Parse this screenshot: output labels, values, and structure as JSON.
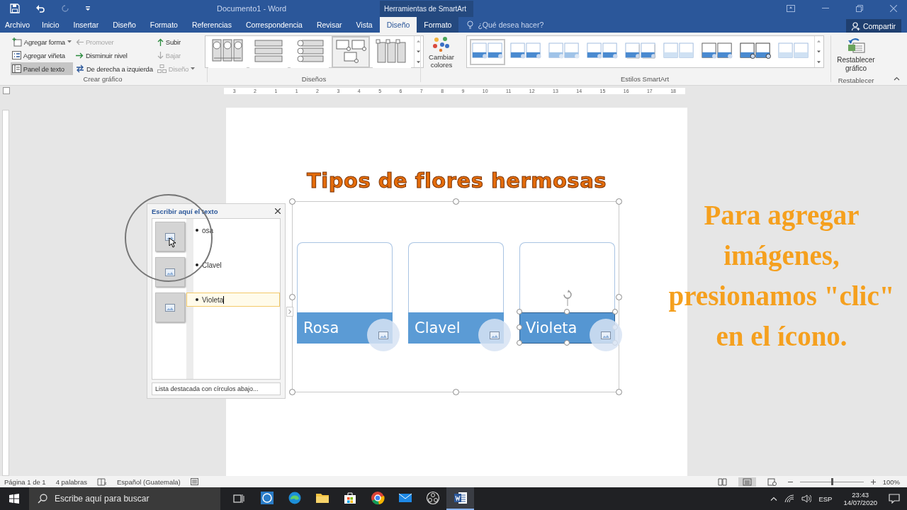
{
  "title_bar": {
    "document_title": "Documento1 - Word",
    "context_title": "Herramientas de SmartArt"
  },
  "ribbon_tabs": [
    {
      "label": "Archivo",
      "selected": false,
      "kind": "file"
    },
    {
      "label": "Inicio",
      "selected": false,
      "kind": "main"
    },
    {
      "label": "Insertar",
      "selected": false,
      "kind": "main"
    },
    {
      "label": "Diseño",
      "selected": false,
      "kind": "main"
    },
    {
      "label": "Formato",
      "selected": false,
      "kind": "main"
    },
    {
      "label": "Referencias",
      "selected": false,
      "kind": "main"
    },
    {
      "label": "Correspondencia",
      "selected": false,
      "kind": "main"
    },
    {
      "label": "Revisar",
      "selected": false,
      "kind": "main"
    },
    {
      "label": "Vista",
      "selected": false,
      "kind": "main"
    },
    {
      "label": "Diseño",
      "selected": true,
      "kind": "context"
    },
    {
      "label": "Formato",
      "selected": false,
      "kind": "context"
    }
  ],
  "tell_me": {
    "placeholder": "¿Qué desea hacer?"
  },
  "share_button": "Compartir",
  "create_group": {
    "label": "Crear gráfico",
    "columns": [
      [
        {
          "label": "Agregar forma",
          "kind": "add-shape",
          "disabled": false,
          "selected": false,
          "dropdown": true
        },
        {
          "label": "Agregar viñeta",
          "kind": "add-bullet",
          "disabled": false,
          "selected": false,
          "dropdown": false
        },
        {
          "label": "Panel de texto",
          "kind": "text-pane",
          "disabled": false,
          "selected": true,
          "dropdown": false
        }
      ],
      [
        {
          "label": "Promover",
          "kind": "promote",
          "disabled": true,
          "selected": false,
          "dropdown": false
        },
        {
          "label": "Disminuir nivel",
          "kind": "demote",
          "disabled": false,
          "selected": false,
          "dropdown": false
        },
        {
          "label": "De derecha a izquierda",
          "kind": "rtl",
          "disabled": false,
          "selected": false,
          "dropdown": false
        }
      ],
      [
        {
          "label": "Subir",
          "kind": "up",
          "disabled": false,
          "selected": false,
          "dropdown": false
        },
        {
          "label": "Bajar",
          "kind": "down",
          "disabled": true,
          "selected": false,
          "dropdown": false
        },
        {
          "label": "Diseño",
          "kind": "layout",
          "disabled": true,
          "selected": false,
          "dropdown": true
        }
      ]
    ]
  },
  "layouts_group": {
    "label": "Diseños",
    "layouts": [
      {
        "kind": "circles-columns",
        "selected": false
      },
      {
        "kind": "boxes-rows",
        "selected": false
      },
      {
        "kind": "circle-rows",
        "selected": false
      },
      {
        "kind": "picture-accent",
        "selected": true
      },
      {
        "kind": "check-columns",
        "selected": false
      }
    ]
  },
  "change_colors": {
    "label": "Cambiar colores"
  },
  "styles_group": {
    "label": "Estilos SmartArt",
    "styles": [
      {
        "kind": "flat",
        "selected": true
      },
      {
        "kind": "flat",
        "selected": false
      },
      {
        "kind": "light",
        "selected": false
      },
      {
        "kind": "flat",
        "selected": false
      },
      {
        "kind": "shadow",
        "selected": false
      },
      {
        "kind": "faded",
        "selected": false
      },
      {
        "kind": "outline",
        "selected": false
      },
      {
        "kind": "dark-outline",
        "selected": false
      },
      {
        "kind": "faded",
        "selected": false
      }
    ]
  },
  "reset_group": {
    "label": "Restablecer",
    "button": "Restablecer gráfico"
  },
  "ruler": [
    "3",
    "2",
    "1",
    "1",
    "2",
    "3",
    "4",
    "5",
    "6",
    "7",
    "8",
    "9",
    "10",
    "11",
    "12",
    "13",
    "14",
    "15",
    "16",
    "17",
    "18"
  ],
  "document": {
    "heading": "Tipos de flores hermosas",
    "smartart": [
      {
        "label": "Rosa",
        "selected": false
      },
      {
        "label": "Clavel",
        "selected": false
      },
      {
        "label": "Violeta",
        "selected": true
      }
    ]
  },
  "text_pane": {
    "title": "Escribir aquí el texto",
    "items": [
      {
        "text": "osa",
        "editing": false
      },
      {
        "text": "Clavel",
        "editing": false
      },
      {
        "text": "Violeta",
        "editing": true
      }
    ],
    "footer": "Lista destacada con círculos abajo..."
  },
  "annotation": "Para agregar imágenes, presionamos \"clic\" en el ícono.",
  "status_bar": {
    "page": "Página 1 de 1",
    "words": "4 palabras",
    "language": "Español (Guatemala)",
    "views": [
      {
        "kind": "read",
        "selected": false
      },
      {
        "kind": "print",
        "selected": true
      },
      {
        "kind": "web",
        "selected": false
      }
    ],
    "zoom_slider": {
      "level": 0.5
    },
    "zoom": "100%"
  },
  "taskbar": {
    "search_placeholder": "Escribe aquí para buscar",
    "apps": [
      {
        "kind": "chat",
        "selected": false
      },
      {
        "kind": "edge",
        "selected": false
      },
      {
        "kind": "folder",
        "selected": false
      },
      {
        "kind": "store",
        "selected": false
      },
      {
        "kind": "chrome",
        "selected": false
      },
      {
        "kind": "mail",
        "selected": false
      },
      {
        "kind": "obs",
        "selected": false
      },
      {
        "kind": "word",
        "selected": true
      }
    ],
    "language": "ESP",
    "time": "23:43",
    "date": "14/07/2020"
  }
}
